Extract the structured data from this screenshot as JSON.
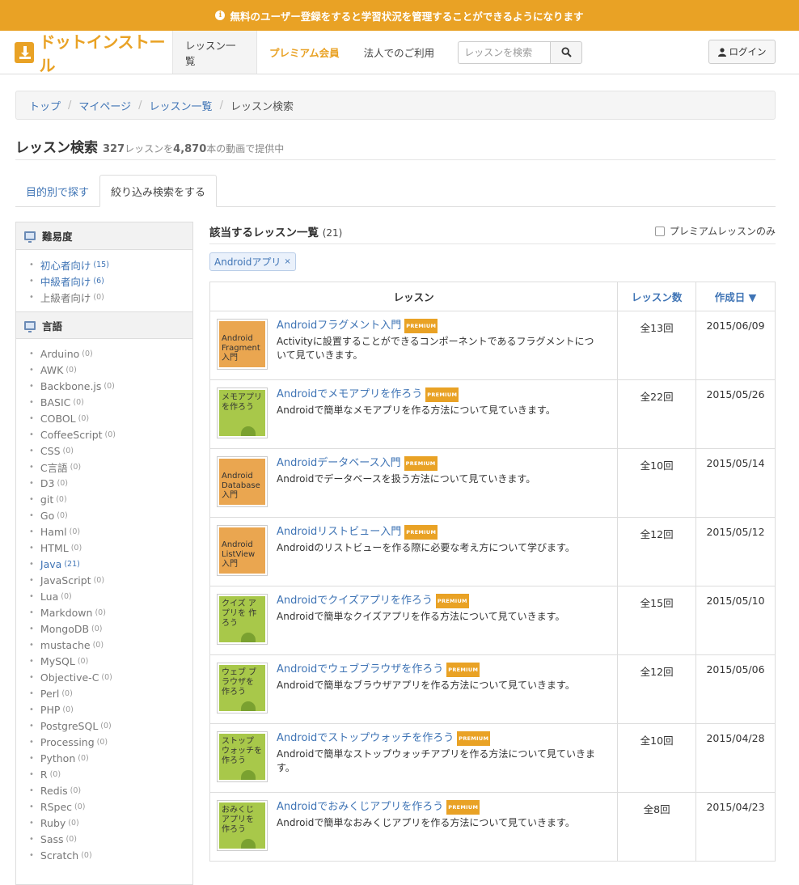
{
  "banner": {
    "icon": "info-icon",
    "text": "無料のユーザー登録をすると学習状況を管理することができるようになります"
  },
  "nav": {
    "logo_text": "ドットインストール",
    "items": [
      {
        "label": "レッスン一覧"
      },
      {
        "label": "プレミアム会員"
      },
      {
        "label": "法人でのご利用"
      }
    ],
    "search_placeholder": "レッスンを検索",
    "login_label": "ログイン"
  },
  "breadcrumb": {
    "items": [
      "トップ",
      "マイページ",
      "レッスン一覧"
    ],
    "current": "レッスン検索"
  },
  "page": {
    "title": "レッスン検索",
    "lesson_count": "327",
    "lesson_suffix": "レッスンを",
    "video_count": "4,870",
    "video_suffix": "本の動画で提供中"
  },
  "tabs": [
    {
      "label": "目的別で探す"
    },
    {
      "label": "絞り込み検索をする"
    }
  ],
  "sidebar": {
    "difficulty": {
      "title": "難易度",
      "items": [
        {
          "label": "初心者向け",
          "count": "(15)"
        },
        {
          "label": "中級者向け",
          "count": "(6)"
        },
        {
          "label": "上級者向け",
          "count": "(0)"
        }
      ]
    },
    "language": {
      "title": "言語",
      "items": [
        {
          "label": "Arduino",
          "count": "(0)"
        },
        {
          "label": "AWK",
          "count": "(0)"
        },
        {
          "label": "Backbone.js",
          "count": "(0)"
        },
        {
          "label": "BASIC",
          "count": "(0)"
        },
        {
          "label": "COBOL",
          "count": "(0)"
        },
        {
          "label": "CoffeeScript",
          "count": "(0)"
        },
        {
          "label": "CSS",
          "count": "(0)"
        },
        {
          "label": "C言語",
          "count": "(0)"
        },
        {
          "label": "D3",
          "count": "(0)"
        },
        {
          "label": "git",
          "count": "(0)"
        },
        {
          "label": "Go",
          "count": "(0)"
        },
        {
          "label": "Haml",
          "count": "(0)"
        },
        {
          "label": "HTML",
          "count": "(0)"
        },
        {
          "label": "Java",
          "count": "(21)"
        },
        {
          "label": "JavaScript",
          "count": "(0)"
        },
        {
          "label": "Lua",
          "count": "(0)"
        },
        {
          "label": "Markdown",
          "count": "(0)"
        },
        {
          "label": "MongoDB",
          "count": "(0)"
        },
        {
          "label": "mustache",
          "count": "(0)"
        },
        {
          "label": "MySQL",
          "count": "(0)"
        },
        {
          "label": "Objective-C",
          "count": "(0)"
        },
        {
          "label": "Perl",
          "count": "(0)"
        },
        {
          "label": "PHP",
          "count": "(0)"
        },
        {
          "label": "PostgreSQL",
          "count": "(0)"
        },
        {
          "label": "Processing",
          "count": "(0)"
        },
        {
          "label": "Python",
          "count": "(0)"
        },
        {
          "label": "R",
          "count": "(0)"
        },
        {
          "label": "Redis",
          "count": "(0)"
        },
        {
          "label": "RSpec",
          "count": "(0)"
        },
        {
          "label": "Ruby",
          "count": "(0)"
        },
        {
          "label": "Sass",
          "count": "(0)"
        },
        {
          "label": "Scratch",
          "count": "(0)"
        }
      ]
    }
  },
  "results": {
    "title": "該当するレッスン一覧",
    "count": "(21)",
    "premium_filter_label": "プレミアムレッスンのみ",
    "active_tag": "Androidアプリ",
    "tag_remove": "×",
    "columns": {
      "lesson": "レッスン",
      "count": "レッスン数",
      "date": "作成日 ▼"
    },
    "badge": "PREMIUM",
    "rows": [
      {
        "thumb": "Android Fragment 入門",
        "thumb_color": "orange",
        "title": "Androidフラグメント入門",
        "desc": "Activityに設置することができるコンポーネントであるフラグメントについて見ていきます。",
        "count": "全13回",
        "date": "2015/06/09"
      },
      {
        "thumb": "メモアプリを作ろう",
        "thumb_color": "green",
        "title": "Androidでメモアプリを作ろう",
        "desc": "Androidで簡単なメモアプリを作る方法について見ていきます。",
        "count": "全22回",
        "date": "2015/05/26"
      },
      {
        "thumb": "Android Database 入門",
        "thumb_color": "orange",
        "title": "Androidデータベース入門",
        "desc": "Androidでデータベースを扱う方法について見ていきます。",
        "count": "全10回",
        "date": "2015/05/14"
      },
      {
        "thumb": "Android ListView 入門",
        "thumb_color": "orange",
        "title": "Androidリストビュー入門",
        "desc": "Androidのリストビューを作る際に必要な考え方について学びます。",
        "count": "全12回",
        "date": "2015/05/12"
      },
      {
        "thumb": "クイズ アプリを 作ろう",
        "thumb_color": "green",
        "title": "Androidでクイズアプリを作ろう",
        "desc": "Androidで簡単なクイズアプリを作る方法について見ていきます。",
        "count": "全15回",
        "date": "2015/05/10"
      },
      {
        "thumb": "ウェブ ブラウザを 作ろう",
        "thumb_color": "green",
        "title": "Androidでウェブブラウザを作ろう",
        "desc": "Androidで簡単なブラウザアプリを作る方法について見ていきます。",
        "count": "全12回",
        "date": "2015/05/06"
      },
      {
        "thumb": "ストップ ウォッチを 作ろう",
        "thumb_color": "green",
        "title": "Androidでストップウォッチを作ろう",
        "desc": "Androidで簡単なストップウォッチアプリを作る方法について見ていきます。",
        "count": "全10回",
        "date": "2015/04/28"
      },
      {
        "thumb": "おみくじ アプリを 作ろう",
        "thumb_color": "green",
        "title": "Androidでおみくじアプリを作ろう",
        "desc": "Androidで簡単なおみくじアプリを作る方法について見ていきます。",
        "count": "全8回",
        "date": "2015/04/23"
      }
    ]
  }
}
